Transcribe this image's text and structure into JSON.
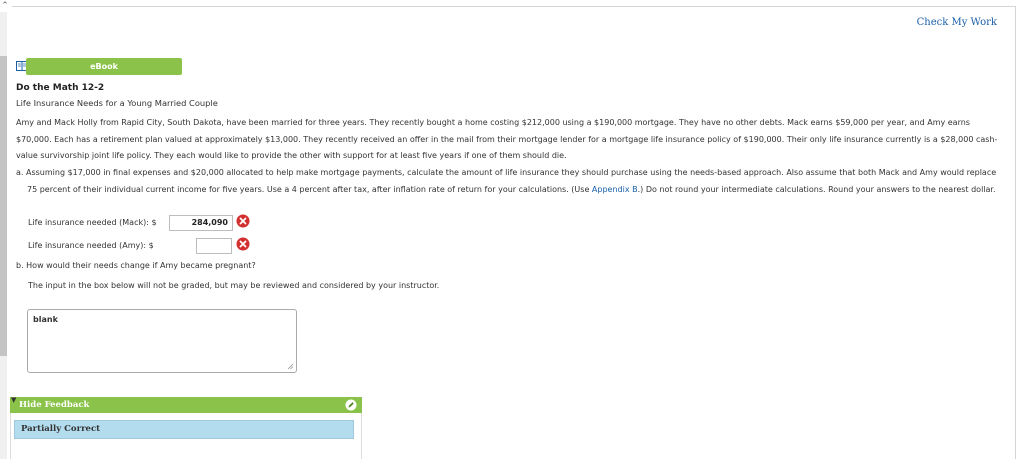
{
  "header": {
    "check_my_work": "Check My Work"
  },
  "ebook": {
    "label": "eBook",
    "icon": "book-icon"
  },
  "problem": {
    "title": "Do the Math 12-2",
    "subtitle": "Life Insurance Needs for a Young Married Couple",
    "paragraph": "Amy and Mack Holly from Rapid City, South Dakota, have been married for three years. They recently bought a home costing $212,000 using a $190,000 mortgage. They have no other debts. Mack earns $59,000 per year, and Amy earns $70,000. Each has a retirement plan valued at approximately $13,000. They recently received an offer in the mail from their mortgage lender for a mortgage life insurance policy of $190,000. Their only life insurance currently is a $28,000 cash-value survivorship joint life policy. They each would like to provide the other with support for at least five years if one of them should die."
  },
  "part_a": {
    "text_before_link": "a. Assuming $17,000 in final expenses and $20,000 allocated to help make mortgage payments, calculate the amount of life insurance they should purchase using the needs-based approach. Also assume that both Mack and Amy would replace 75 percent of their individual current income for five years. Use a 4 percent after tax, after inflation rate of return for your calculations. (Use ",
    "link": "Appendix B",
    "text_after_link": ".) Do not round your intermediate calculations. Round your answers to the nearest dollar.",
    "mack_label": "Life insurance needed (Mack): $",
    "mack_value": "284,090",
    "amy_label": "Life insurance needed (Amy): $",
    "amy_value": ""
  },
  "part_b": {
    "question": "b. How would their needs change if Amy became pregnant?",
    "note": "The input in the box below will not be graded, but may be reviewed and considered by your instructor.",
    "answer": "blank"
  },
  "feedback": {
    "toggle_label": "Hide Feedback",
    "status": "Partially Correct"
  },
  "colors": {
    "accent_green": "#8bc34a",
    "link_blue": "#1a5fa8",
    "error_red": "#d32f2f",
    "status_blue": "#b3dcef"
  }
}
